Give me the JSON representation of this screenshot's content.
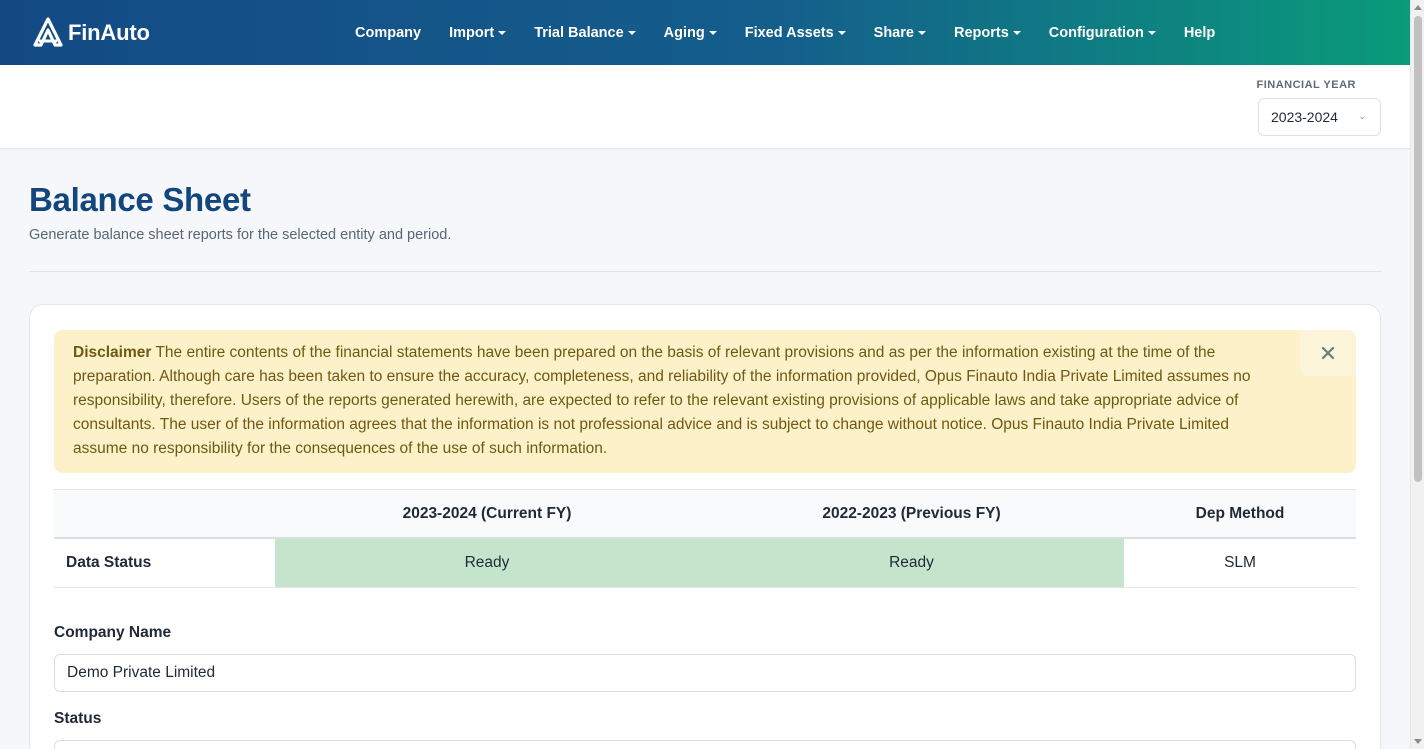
{
  "app": {
    "brand": "FinAuto"
  },
  "nav": [
    {
      "label": "Company",
      "dropdown": false
    },
    {
      "label": "Import",
      "dropdown": true
    },
    {
      "label": "Trial Balance",
      "dropdown": true
    },
    {
      "label": "Aging",
      "dropdown": true
    },
    {
      "label": "Fixed Assets",
      "dropdown": true
    },
    {
      "label": "Share",
      "dropdown": true
    },
    {
      "label": "Reports",
      "dropdown": true
    },
    {
      "label": "Configuration",
      "dropdown": true
    },
    {
      "label": "Help",
      "dropdown": false
    }
  ],
  "financial_year": {
    "label": "FINANCIAL YEAR",
    "value": "2023-2024"
  },
  "page": {
    "title": "Balance Sheet",
    "subtitle": "Generate balance sheet reports for the selected entity and period."
  },
  "disclaimer": {
    "heading": "Disclaimer",
    "text": "The entire contents of the financial statements have been prepared on the basis of relevant provisions and as per the information existing at the time of the preparation. Although care has been taken to ensure the accuracy, completeness, and reliability of the information provided, Opus Finauto India Private Limited assumes no responsibility, therefore. Users of the reports generated herewith, are expected to refer to the relevant existing provisions of applicable laws and take appropriate advice of consultants. The user of the information agrees that the information is not professional advice and is subject to change without notice. Opus Finauto India Private Limited assume no responsibility for the consequences of the use of such information."
  },
  "status_table": {
    "headers": [
      "",
      "2023-2024 (Current FY)",
      "2022-2023 (Previous FY)",
      "Dep Method"
    ],
    "row": {
      "label": "Data Status",
      "current": "Ready",
      "previous": "Ready",
      "dep_method": "SLM"
    }
  },
  "form": {
    "company_name_label": "Company Name",
    "company_name_value": "Demo Private Limited",
    "status_label": "Status"
  },
  "colors": {
    "brand_blue": "#12467d",
    "ready_green": "#c4e5cc",
    "alert_bg": "#fdf1c9"
  }
}
